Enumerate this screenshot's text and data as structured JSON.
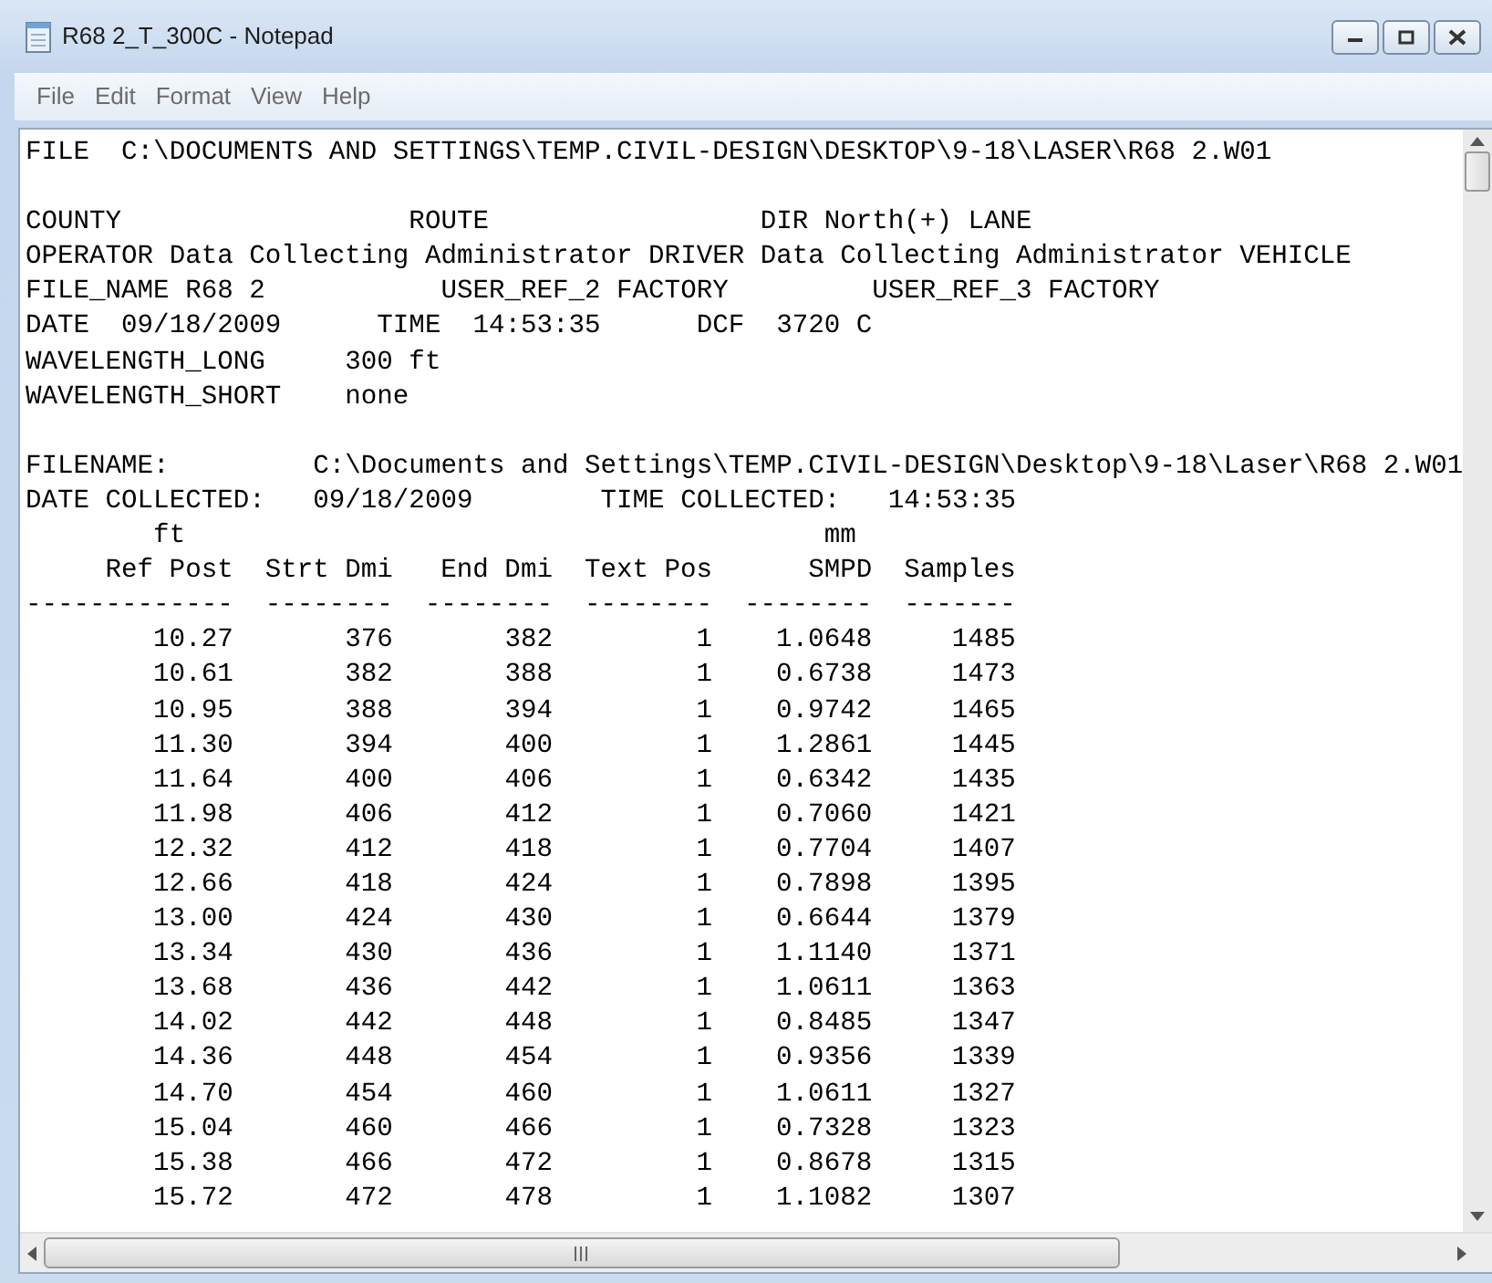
{
  "window": {
    "title": "R68 2_T_300C - Notepad"
  },
  "menu": [
    "File",
    "Edit",
    "Format",
    "View",
    "Help"
  ],
  "document": {
    "lines": [
      {
        "kind": "text",
        "text": "FILE  C:\\DOCUMENTS AND SETTINGS\\TEMP.CIVIL-DESIGN\\DESKTOP\\9-18\\LASER\\R68 2.W01"
      },
      {
        "kind": "blank"
      },
      {
        "kind": "text",
        "text": "COUNTY                  ROUTE                 DIR North(+) LANE"
      },
      {
        "kind": "text",
        "text": "OPERATOR Data Collecting Administrator DRIVER Data Collecting Administrator VEHICLE"
      },
      {
        "kind": "text",
        "text": "FILE_NAME R68 2           USER_REF_2 FACTORY         USER_REF_3 FACTORY"
      },
      {
        "kind": "text",
        "text": "DATE  09/18/2009      TIME  14:53:35      DCF  3720 C"
      },
      {
        "kind": "text",
        "text": "WAVELENGTH_LONG     300 ft"
      },
      {
        "kind": "text",
        "text": "WAVELENGTH_SHORT    none"
      },
      {
        "kind": "blank"
      },
      {
        "kind": "text",
        "text": "FILENAME:         C:\\Documents and Settings\\TEMP.CIVIL-DESIGN\\Desktop\\9-18\\Laser\\R68 2.W01"
      },
      {
        "kind": "text",
        "text": "DATE COLLECTED:   09/18/2009        TIME COLLECTED:   14:53:35"
      },
      {
        "kind": "text",
        "text": "        ft                                        mm"
      }
    ]
  },
  "table": {
    "columns": [
      {
        "heading": "Ref Post",
        "rule": "-------------"
      },
      {
        "heading": "Strt Dmi",
        "rule": "--------"
      },
      {
        "heading": "End Dmi",
        "rule": "--------"
      },
      {
        "heading": "Text Pos",
        "rule": "--------"
      },
      {
        "heading": "SMPD",
        "rule": "--------"
      },
      {
        "heading": "Samples",
        "rule": "-------"
      }
    ],
    "rows": [
      [
        "10.27",
        "376",
        "382",
        "1",
        "1.0648",
        "1485"
      ],
      [
        "10.61",
        "382",
        "388",
        "1",
        "0.6738",
        "1473"
      ],
      [
        "10.95",
        "388",
        "394",
        "1",
        "0.9742",
        "1465"
      ],
      [
        "11.30",
        "394",
        "400",
        "1",
        "1.2861",
        "1445"
      ],
      [
        "11.64",
        "400",
        "406",
        "1",
        "0.6342",
        "1435"
      ],
      [
        "11.98",
        "406",
        "412",
        "1",
        "0.7060",
        "1421"
      ],
      [
        "12.32",
        "412",
        "418",
        "1",
        "0.7704",
        "1407"
      ],
      [
        "12.66",
        "418",
        "424",
        "1",
        "0.7898",
        "1395"
      ],
      [
        "13.00",
        "424",
        "430",
        "1",
        "0.6644",
        "1379"
      ],
      [
        "13.34",
        "430",
        "436",
        "1",
        "1.1140",
        "1371"
      ],
      [
        "13.68",
        "436",
        "442",
        "1",
        "1.0611",
        "1363"
      ],
      [
        "14.02",
        "442",
        "448",
        "1",
        "0.8485",
        "1347"
      ],
      [
        "14.36",
        "448",
        "454",
        "1",
        "0.9356",
        "1339"
      ],
      [
        "14.70",
        "454",
        "460",
        "1",
        "1.0611",
        "1327"
      ],
      [
        "15.04",
        "460",
        "466",
        "1",
        "0.7328",
        "1323"
      ],
      [
        "15.38",
        "466",
        "472",
        "1",
        "0.8678",
        "1315"
      ],
      [
        "15.72",
        "472",
        "478",
        "1",
        "1.1082",
        "1307"
      ]
    ]
  }
}
